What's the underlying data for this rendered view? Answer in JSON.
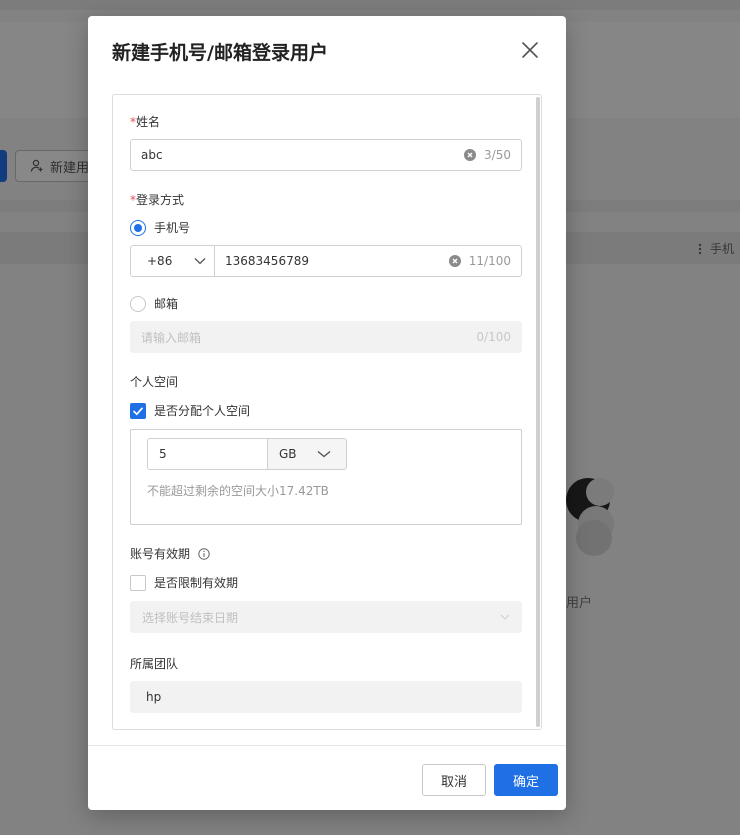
{
  "background": {
    "new_button_label": "新建用",
    "column_header": "手机",
    "empty_state_text": "用户"
  },
  "modal": {
    "title": "新建手机号/邮箱登录用户",
    "fields": {
      "name": {
        "required_mark": "*",
        "label": "姓名",
        "value": "abc",
        "count": "3/50"
      },
      "login_method": {
        "required_mark": "*",
        "label": "登录方式",
        "phone_option_label": "手机号",
        "phone_selected": true,
        "country_code": "+86",
        "phone_value": "13683456789",
        "phone_count": "11/100",
        "email_option_label": "邮箱",
        "email_selected": false,
        "email_placeholder": "请输入邮箱",
        "email_count": "0/100"
      },
      "personal_space": {
        "label": "个人空间",
        "assign_checkbox_label": "是否分配个人空间",
        "assign_checked": true,
        "size_value": "5",
        "unit": "GB",
        "hint": "不能超过剩余的空间大小17.42TB"
      },
      "account_validity": {
        "label": "账号有效期",
        "limit_checkbox_label": "是否限制有效期",
        "limit_checked": false,
        "end_date_placeholder": "选择账号结束日期"
      },
      "team": {
        "label": "所属团队",
        "value": "hp"
      }
    },
    "footer": {
      "cancel_label": "取消",
      "confirm_label": "确定"
    }
  },
  "colors": {
    "primary": "#1f6fe5",
    "required": "#e34d59"
  }
}
